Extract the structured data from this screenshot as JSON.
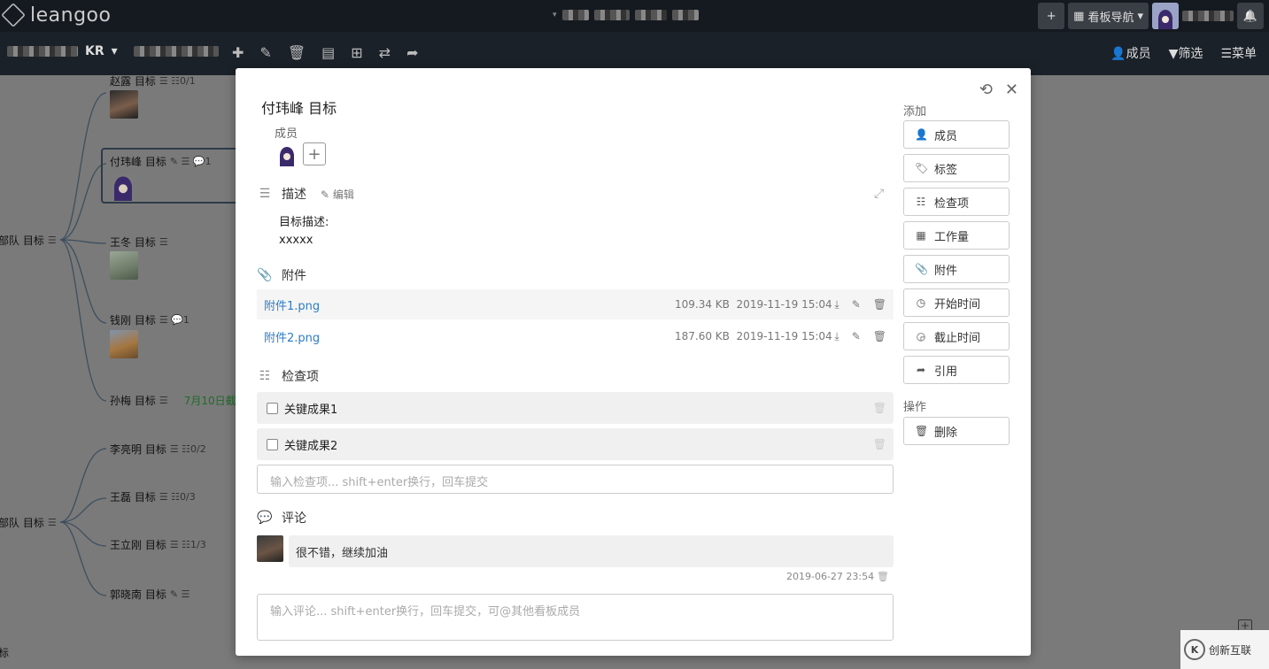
{
  "app": {
    "logo_text": "leangoo"
  },
  "topbar": {
    "add_icon": "+",
    "board_nav_label": "看板导航",
    "board_nav_arrow": "▾",
    "bell_icon": "🔔"
  },
  "toolbar": {
    "board_title": "KR",
    "board_arrow": "▾",
    "members_label": "成员",
    "filter_label": "筛选",
    "menu_label": "菜单"
  },
  "canvas": {
    "nodes": [
      {
        "label": "赵露 目标",
        "meta": "☰ ☷0/1"
      },
      {
        "label": "付玮峰 目标",
        "meta": "✎ ☰ 💬1"
      },
      {
        "label": "王冬 目标",
        "meta": "☰"
      },
      {
        "label": "钱刚 目标",
        "meta": "☰ 💬1"
      },
      {
        "label": "孙梅 目标",
        "meta": "☰"
      },
      {
        "label": "7月10日截",
        "meta": ""
      },
      {
        "label": "李亮明 目标",
        "meta": "☰ ☷0/2"
      },
      {
        "label": "王磊 目标",
        "meta": "☰ ☷0/3"
      },
      {
        "label": "王立刚 目标",
        "meta": "☰ ☷1/3"
      },
      {
        "label": "郭晓南 目标",
        "meta": "✎ ☰"
      },
      {
        "label": "部队 目标",
        "meta": "☰"
      },
      {
        "label": "部队 目标",
        "meta": "☰"
      },
      {
        "label": "标",
        "meta": ""
      }
    ]
  },
  "modal": {
    "title": "付玮峰 目标",
    "members_label": "成员",
    "description": {
      "heading": "描述",
      "edit_label": "编辑",
      "line1": "目标描述:",
      "line2": "xxxxx"
    },
    "attachments": {
      "heading": "附件",
      "items": [
        {
          "name": "附件1.png",
          "size": "109.34 KB",
          "date": "2019-11-19 15:04"
        },
        {
          "name": "附件2.png",
          "size": "187.60 KB",
          "date": "2019-11-19 15:04"
        }
      ]
    },
    "checklist": {
      "heading": "检查项",
      "items": [
        {
          "label": "关键成果1",
          "checked": false
        },
        {
          "label": "关键成果2",
          "checked": false
        }
      ],
      "input_placeholder": "输入检查项... shift+enter换行，回车提交"
    },
    "comments": {
      "heading": "评论",
      "items": [
        {
          "text": "很不错，继续加油",
          "time": "2019-06-27 23:54"
        }
      ],
      "input_placeholder": "输入评论... shift+enter换行，回车提交，可@其他看板成员"
    },
    "sidebar": {
      "add_label": "添加",
      "add_buttons": [
        {
          "label": "成员",
          "icon": "add-user-icon"
        },
        {
          "label": "标签",
          "icon": "tag-icon"
        },
        {
          "label": "检查项",
          "icon": "list-icon"
        },
        {
          "label": "工作量",
          "icon": "grid-icon"
        },
        {
          "label": "附件",
          "icon": "paperclip-icon"
        },
        {
          "label": "开始时间",
          "icon": "clock-icon"
        },
        {
          "label": "截止时间",
          "icon": "clock-icon"
        },
        {
          "label": "引用",
          "icon": "share-icon"
        }
      ],
      "actions_label": "操作",
      "delete_label": "删除"
    }
  },
  "watermark": {
    "text": "创新互联"
  }
}
